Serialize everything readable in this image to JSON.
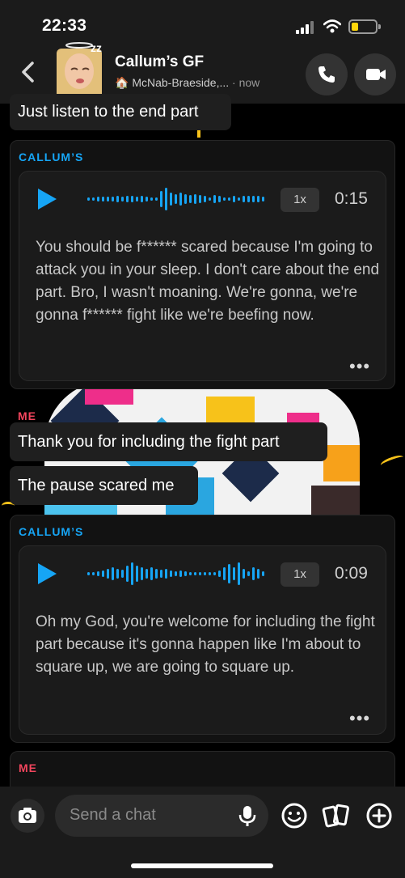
{
  "status": {
    "time": "22:33"
  },
  "header": {
    "title": "Callum’s GF",
    "location": "🏠 McNab-Braeside,...",
    "separator": " · ",
    "last_seen": "now"
  },
  "messages": {
    "top_partial": "Just listen to the end part",
    "voice1": {
      "sender": "CALLUM’S",
      "speed": "1x",
      "duration": "0:15",
      "transcript": "You should be f****** scared because I'm going to attack you in your sleep. I don't care about the end part. Bro, I wasn't moaning. We're gonna, we're gonna f****** fight like we're beefing now.",
      "more": "•••"
    },
    "me1": {
      "sender": "ME",
      "line1": "Thank you for including the fight part",
      "line2": "The pause scared me"
    },
    "voice2": {
      "sender": "CALLUM’S",
      "speed": "1x",
      "duration": "0:09",
      "transcript": "Oh my God, you're welcome for including the fight part because it's gonna happen like I'm about to square up, we are going to square up.",
      "more": "•••"
    },
    "me2": {
      "sender": "ME"
    }
  },
  "composer": {
    "placeholder": "Send a chat"
  },
  "colors": {
    "them": "#16a5f5",
    "me": "#f2455d",
    "battery": "#ffd60a"
  },
  "icons": [
    "back-icon",
    "phone-icon",
    "video-icon",
    "play-icon",
    "waveform-icon",
    "camera-icon",
    "microphone-icon",
    "emoji-icon",
    "cards-icon",
    "add-icon"
  ]
}
